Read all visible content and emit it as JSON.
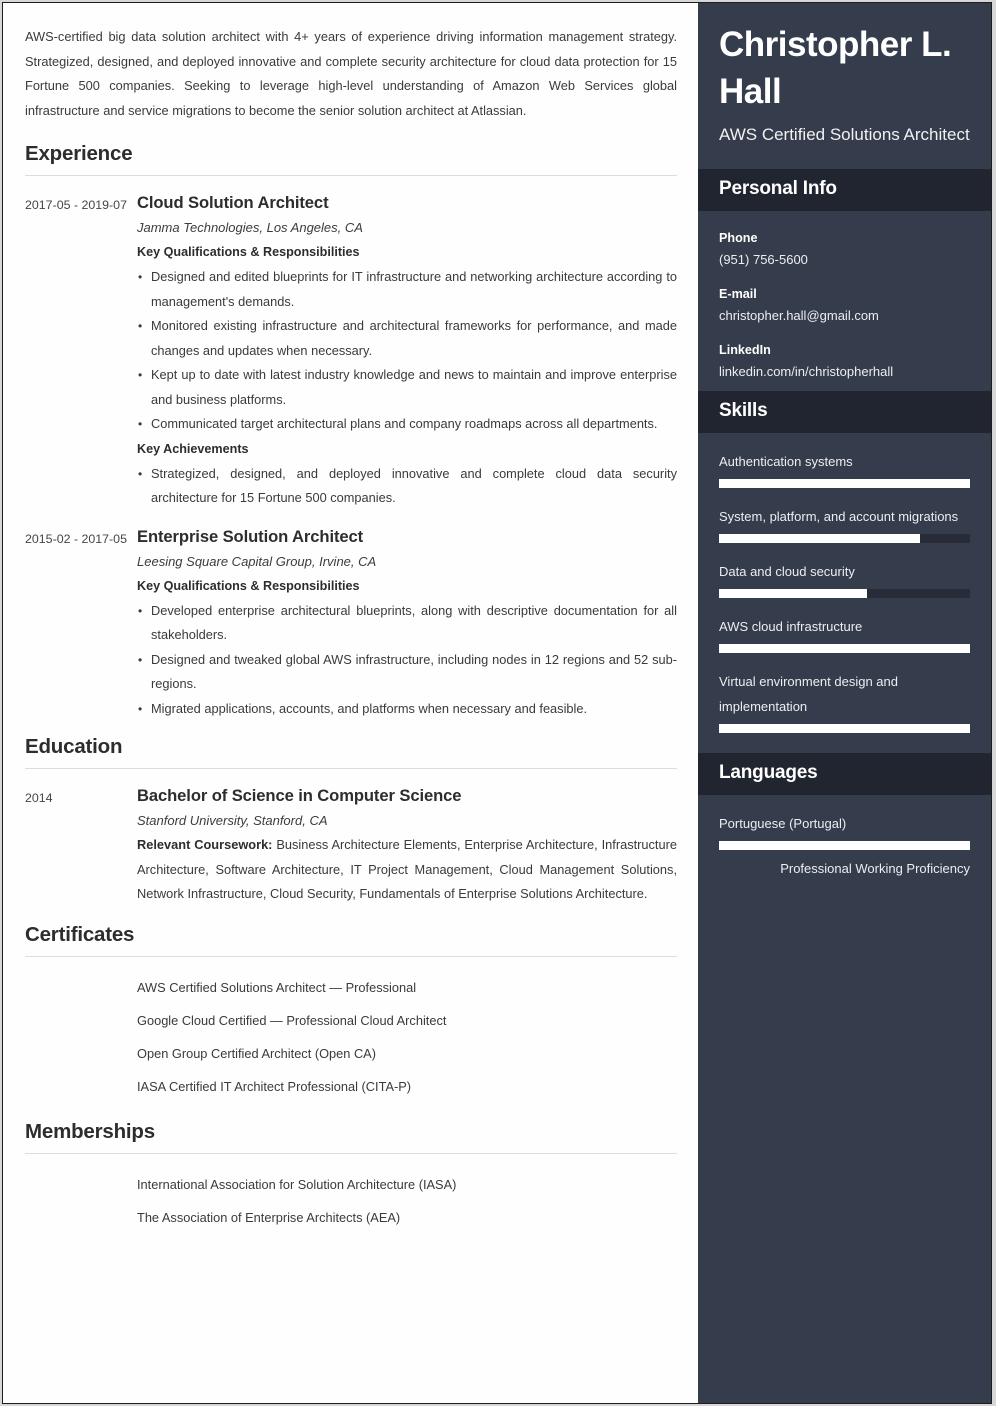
{
  "theme": {
    "sidebar_bg": "#353c4b",
    "sidebar_header_bg": "#21252f",
    "bar_track": "#272c38",
    "bar_fill": "#ffffff",
    "page_bg": "#ffffff",
    "text": "#3a3a3a"
  },
  "main": {
    "summary": "AWS-certified big data solution architect with 4+ years of experience driving information management strategy. Strategized, designed, and deployed innovative and complete security architecture for cloud data protection for 15 Fortune 500 companies. Seeking to leverage high-level understanding of Amazon Web Services global infrastructure and service migrations to become the senior solution architect at Atlassian.",
    "sections": {
      "experience": {
        "title": "Experience",
        "entries": [
          {
            "date": "2017-05 - 2019-07",
            "title": "Cloud Solution Architect",
            "subtitle": "Jamma Technologies, Los Angeles, CA",
            "qualifications_label": "Key Qualifications & Responsibilities",
            "bullets": [
              "Designed and edited blueprints for IT infrastructure and networking architecture according to management's demands.",
              "Monitored existing infrastructure and architectural frameworks for performance, and made changes and updates when necessary.",
              "Kept up to date with latest industry knowledge and news to maintain and improve enterprise and business platforms.",
              "Communicated target architectural plans and company roadmaps across all departments."
            ],
            "achievements_label": "Key Achievements",
            "achievements": [
              "Strategized, designed, and deployed innovative and complete cloud data security architecture for 15 Fortune 500 companies."
            ]
          },
          {
            "date": "2015-02 - 2017-05",
            "title": "Enterprise Solution Architect",
            "subtitle": "Leesing Square Capital Group, Irvine, CA",
            "qualifications_label": "Key Qualifications & Responsibilities",
            "bullets": [
              "Developed enterprise architectural blueprints, along with descriptive documentation for all stakeholders.",
              "Designed and tweaked global AWS infrastructure, including nodes in 12 regions and 52 sub-regions.",
              "Migrated applications, accounts, and platforms when necessary and feasible."
            ]
          }
        ]
      },
      "education": {
        "title": "Education",
        "date": "2014",
        "degree": "Bachelor of Science in Computer Science",
        "school": "Stanford University, Stanford, CA",
        "coursework_label": "Relevant Coursework:",
        "coursework": " Business Architecture Elements, Enterprise Architecture, Infrastructure Architecture, Software Architecture, IT Project Management, Cloud Management Solutions, Network Infrastructure, Cloud Security, Fundamentals of Enterprise Solutions Architecture."
      },
      "certificates": {
        "title": "Certificates",
        "items": [
          "AWS Certified Solutions Architect — Professional",
          "Google Cloud Certified — Professional Cloud Architect",
          "Open Group Certified Architect (Open CA)",
          "IASA Certified IT Architect Professional (CITA-P)"
        ]
      },
      "memberships": {
        "title": "Memberships",
        "items": [
          "International Association for Solution Architecture (IASA)",
          "The Association of Enterprise Architects (AEA)"
        ]
      }
    }
  },
  "sidebar": {
    "name": "Christopher L. Hall",
    "role": "AWS Certified Solutions Architect",
    "personal_info": {
      "title": "Personal Info",
      "fields": [
        {
          "label": "Phone",
          "value": "(951) 756-5600"
        },
        {
          "label": "E-mail",
          "value": "christopher.hall@gmail.com"
        },
        {
          "label": "LinkedIn",
          "value": "linkedin.com/in/christopherhall"
        }
      ]
    },
    "skills": {
      "title": "Skills",
      "items": [
        {
          "label": "Authentication systems",
          "level": 100
        },
        {
          "label": "System, platform, and account migrations",
          "level": 80
        },
        {
          "label": "Data and cloud security",
          "level": 59
        },
        {
          "label": "AWS cloud infrastructure",
          "level": 100
        },
        {
          "label": "Virtual environment design and implementation",
          "level": 100
        }
      ]
    },
    "languages": {
      "title": "Languages",
      "items": [
        {
          "label": "Portuguese (Portugal)",
          "level": 100,
          "proficiency": "Professional Working Proficiency"
        }
      ]
    }
  }
}
